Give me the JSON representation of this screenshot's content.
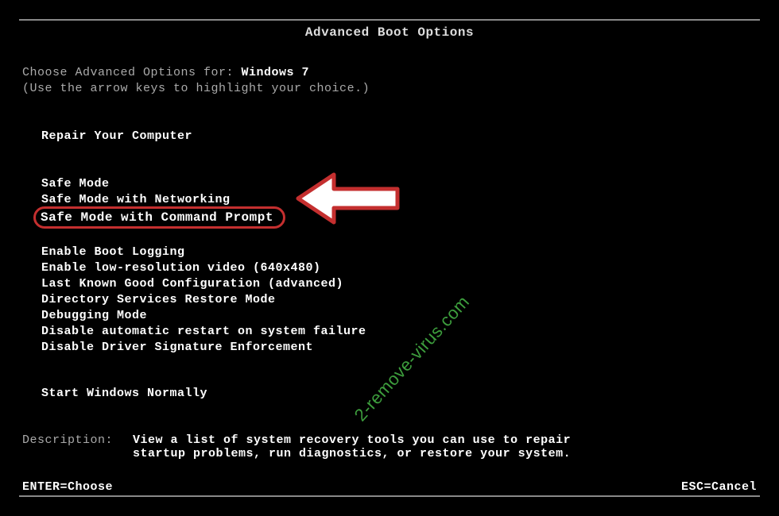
{
  "title": "Advanced Boot Options",
  "prompt": {
    "prefix": "Choose Advanced Options for: ",
    "os": "Windows 7",
    "hint": "(Use the arrow keys to highlight your choice.)"
  },
  "menu": {
    "repair": "Repair Your Computer",
    "group1": [
      "Safe Mode",
      "Safe Mode with Networking"
    ],
    "selected": "Safe Mode with Command Prompt",
    "group2": [
      "Enable Boot Logging",
      "Enable low-resolution video (640x480)",
      "Last Known Good Configuration (advanced)",
      "Directory Services Restore Mode",
      "Debugging Mode",
      "Disable automatic restart on system failure",
      "Disable Driver Signature Enforcement"
    ],
    "normal": "Start Windows Normally"
  },
  "description": {
    "label": "Description:",
    "line1": "View a list of system recovery tools you can use to repair",
    "line2": "startup problems, run diagnostics, or restore your system."
  },
  "footer": {
    "left": "ENTER=Choose",
    "right": "ESC=Cancel"
  },
  "watermark": "2-remove-virus.com"
}
